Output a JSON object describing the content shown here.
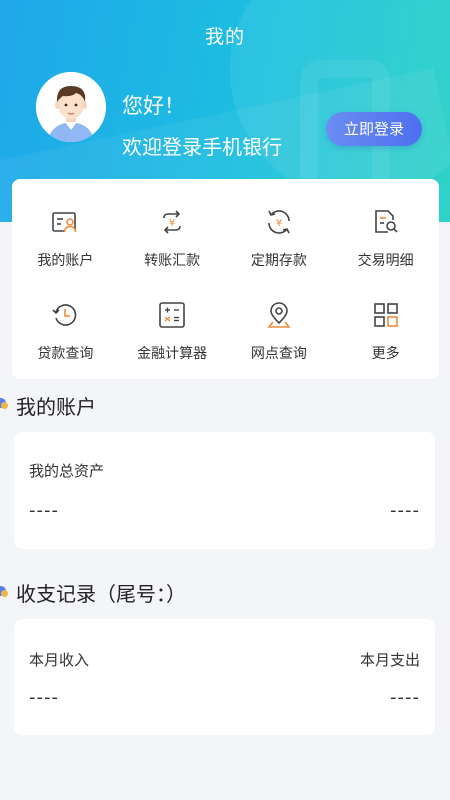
{
  "header": {
    "title": "我的",
    "greeting": "您好！",
    "welcome": "欢迎登录手机银行",
    "login_label": "立即登录"
  },
  "menu": [
    {
      "label": "我的账户",
      "icon": "account-card-icon"
    },
    {
      "label": "转账汇款",
      "icon": "transfer-icon"
    },
    {
      "label": "定期存款",
      "icon": "deposit-icon"
    },
    {
      "label": "交易明细",
      "icon": "transaction-detail-icon"
    },
    {
      "label": "贷款查询",
      "icon": "loan-history-icon"
    },
    {
      "label": "金融计算器",
      "icon": "calculator-icon"
    },
    {
      "label": "网点查询",
      "icon": "location-pin-icon"
    },
    {
      "label": "更多",
      "icon": "more-grid-icon"
    }
  ],
  "accounts": {
    "title": "我的账户",
    "total_assets_label": "我的总资产",
    "left_value": "----",
    "right_value": "----"
  },
  "records": {
    "title": "收支记录（尾号：）",
    "income_label": "本月收入",
    "expense_label": "本月支出",
    "income_value": "----",
    "expense_value": "----"
  },
  "colors": {
    "header_gradient_start": "#1fa7ea",
    "header_gradient_end": "#22d0c5",
    "accent_blue": "#5b7cf0",
    "accent_orange": "#f08b3c",
    "icon_dark": "#444444"
  }
}
